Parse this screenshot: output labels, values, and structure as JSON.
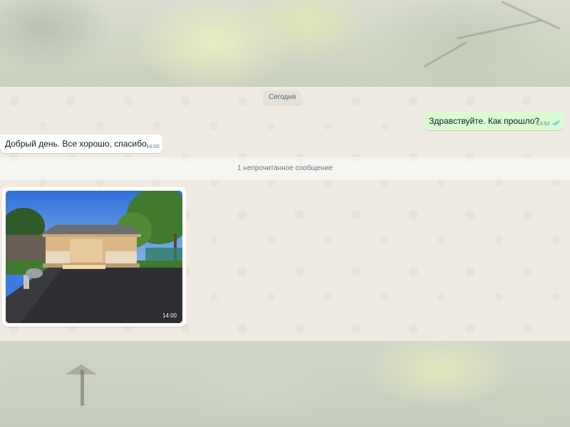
{
  "chat": {
    "date_separator": "Сегодня",
    "messages": [
      {
        "direction": "outgoing",
        "text": "Здравствуйте. Как прошло?",
        "time": "13:52",
        "status": "read"
      },
      {
        "direction": "incoming",
        "text": "Добрый день. Все хорошо, спасибо.",
        "time": "14:00"
      }
    ],
    "unread_label": "1 непрочитанное сообщение",
    "media_message": {
      "type": "photo",
      "subject": "wooden gazebo on a new asphalt area",
      "time": "14:00"
    }
  },
  "colors": {
    "outgoing_bubble": "#d9fdd3",
    "incoming_bubble": "#ffffff",
    "chat_background": "#efeae2",
    "read_ticks": "#53bdeb"
  },
  "icons": {
    "read_status": "double-check-icon"
  }
}
